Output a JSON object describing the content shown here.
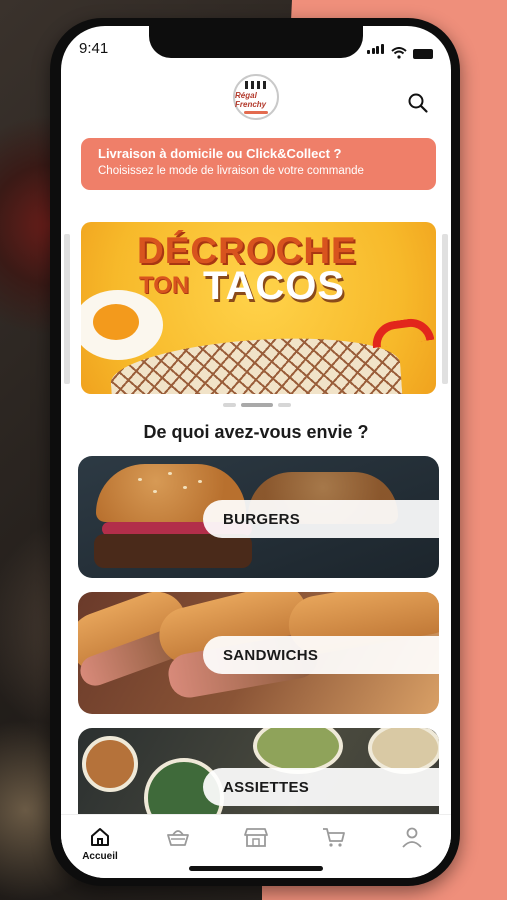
{
  "status_bar": {
    "time": "9:41"
  },
  "header": {
    "logo_text": "Régal Frenchy"
  },
  "delivery_banner": {
    "title": "Livraison à domicile ou Click&Collect ?",
    "subtitle": "Choisissez le mode de livraison de votre commande"
  },
  "promo": {
    "line1": "DÉCROCHE",
    "line2": "TON",
    "line3": "TACOS",
    "slide_count": 3,
    "active_slide": 1
  },
  "section_title": "De quoi avez-vous envie ?",
  "categories": [
    {
      "label": "BURGERS"
    },
    {
      "label": "SANDWICHS"
    },
    {
      "label": "ASSIETTES"
    }
  ],
  "tabbar": {
    "items": [
      {
        "label": "Accueil",
        "icon": "home-icon",
        "active": true
      },
      {
        "label": "",
        "icon": "basket-icon"
      },
      {
        "label": "",
        "icon": "store-icon"
      },
      {
        "label": "",
        "icon": "cart-icon"
      },
      {
        "label": "",
        "icon": "user-icon"
      }
    ]
  },
  "colors": {
    "accent": "#ef7f69",
    "background_coral": "#ef8f7b",
    "promo_yellow": "#f7b92a"
  }
}
